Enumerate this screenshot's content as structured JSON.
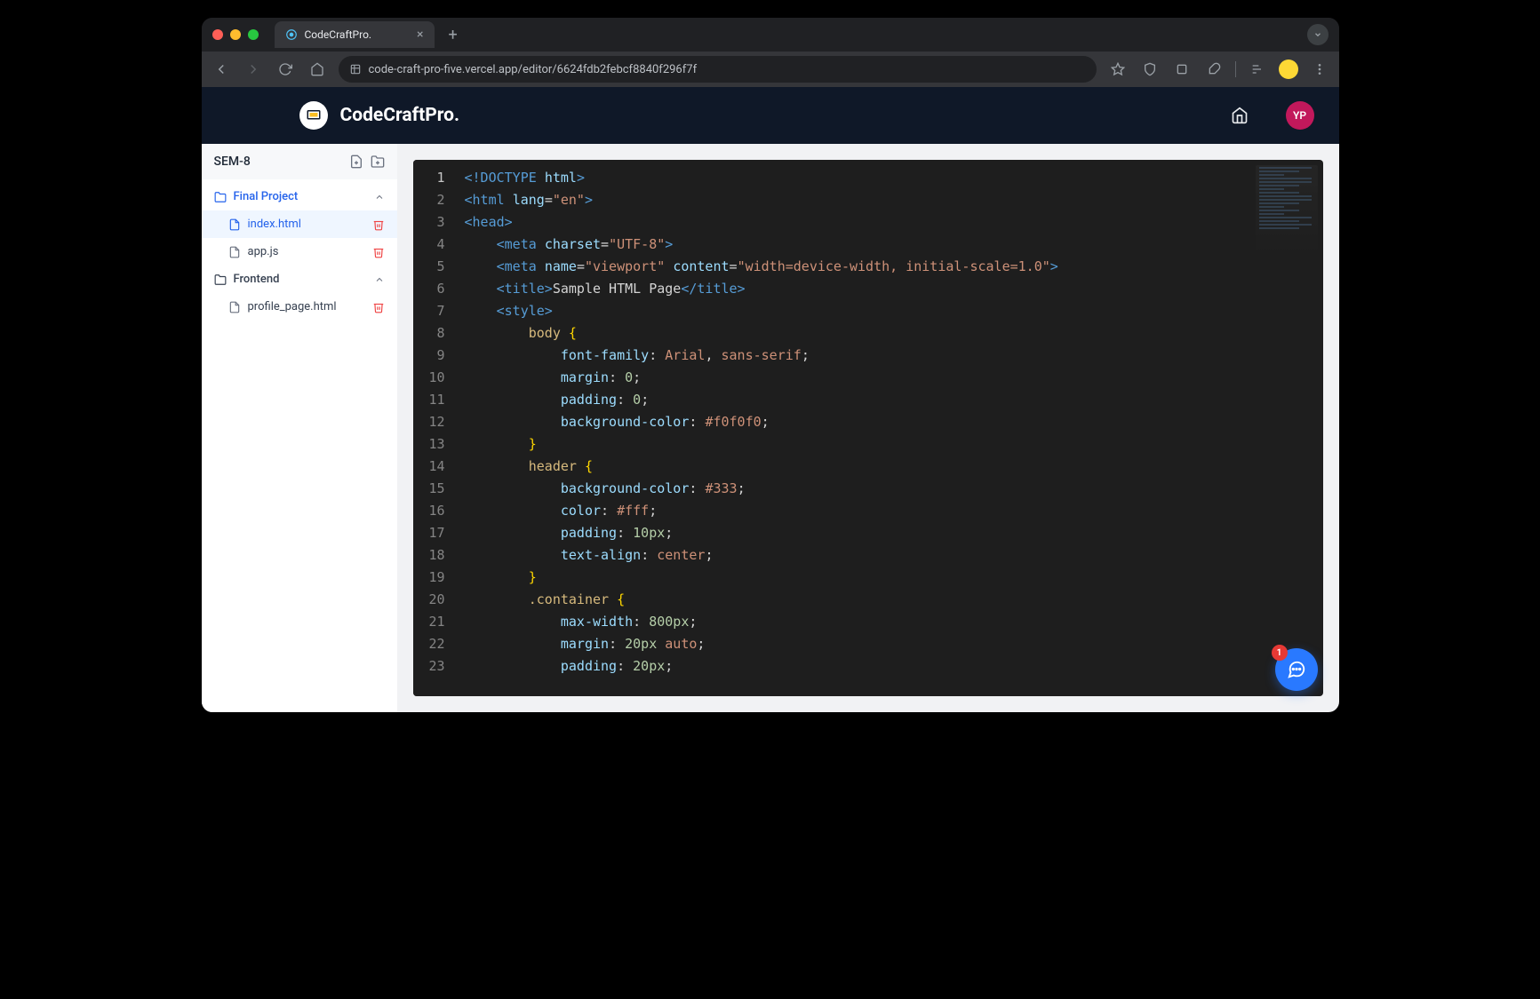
{
  "browser": {
    "tab_title": "CodeCraftPro.",
    "url": "code-craft-pro-five.vercel.app/editor/6624fdb2febcf8840f296f7f"
  },
  "header": {
    "brand": "CodeCraftPro.",
    "avatar_initials": "YP"
  },
  "sidebar": {
    "project_name": "SEM-8",
    "folders": [
      {
        "name": "Final Project",
        "expanded": true,
        "active": true,
        "files": [
          {
            "name": "index.html",
            "active": true
          },
          {
            "name": "app.js",
            "active": false
          }
        ]
      },
      {
        "name": "Frontend",
        "expanded": true,
        "active": false,
        "files": [
          {
            "name": "profile_page.html",
            "active": false
          }
        ]
      }
    ]
  },
  "editor": {
    "line_start": 1,
    "line_end": 23,
    "active_line": 1,
    "lines": [
      {
        "n": 1,
        "tokens": [
          [
            "tag",
            "<!DOCTYPE"
          ],
          [
            "text",
            " "
          ],
          [
            "attr",
            "html"
          ],
          [
            "tag",
            ">"
          ]
        ]
      },
      {
        "n": 2,
        "tokens": [
          [
            "tag",
            "<html"
          ],
          [
            "text",
            " "
          ],
          [
            "attr",
            "lang"
          ],
          [
            "punc",
            "="
          ],
          [
            "str",
            "\"en\""
          ],
          [
            "tag",
            ">"
          ]
        ]
      },
      {
        "n": 3,
        "tokens": [
          [
            "tag",
            "<head>"
          ]
        ]
      },
      {
        "n": 4,
        "indent": 1,
        "tokens": [
          [
            "tag",
            "<meta"
          ],
          [
            "text",
            " "
          ],
          [
            "attr",
            "charset"
          ],
          [
            "punc",
            "="
          ],
          [
            "str",
            "\"UTF-8\""
          ],
          [
            "tag",
            ">"
          ]
        ]
      },
      {
        "n": 5,
        "indent": 1,
        "tokens": [
          [
            "tag",
            "<meta"
          ],
          [
            "text",
            " "
          ],
          [
            "attr",
            "name"
          ],
          [
            "punc",
            "="
          ],
          [
            "str",
            "\"viewport\""
          ],
          [
            "text",
            " "
          ],
          [
            "attr",
            "content"
          ],
          [
            "punc",
            "="
          ],
          [
            "str",
            "\"width=device-width, initial-scale=1.0\""
          ],
          [
            "tag",
            ">"
          ]
        ]
      },
      {
        "n": 6,
        "indent": 1,
        "tokens": [
          [
            "tag",
            "<title>"
          ],
          [
            "text",
            "Sample HTML Page"
          ],
          [
            "tag",
            "</title>"
          ]
        ]
      },
      {
        "n": 7,
        "indent": 1,
        "tokens": [
          [
            "tag",
            "<style>"
          ]
        ]
      },
      {
        "n": 8,
        "indent": 2,
        "tokens": [
          [
            "sel",
            "body"
          ],
          [
            "text",
            " "
          ],
          [
            "brace",
            "{"
          ]
        ]
      },
      {
        "n": 9,
        "indent": 3,
        "tokens": [
          [
            "prop",
            "font-family"
          ],
          [
            "punc",
            ":"
          ],
          [
            "text",
            " "
          ],
          [
            "val",
            "Arial"
          ],
          [
            "punc",
            ","
          ],
          [
            "text",
            " "
          ],
          [
            "val",
            "sans-serif"
          ],
          [
            "punc",
            ";"
          ]
        ]
      },
      {
        "n": 10,
        "indent": 3,
        "tokens": [
          [
            "prop",
            "margin"
          ],
          [
            "punc",
            ":"
          ],
          [
            "text",
            " "
          ],
          [
            "num",
            "0"
          ],
          [
            "punc",
            ";"
          ]
        ]
      },
      {
        "n": 11,
        "indent": 3,
        "tokens": [
          [
            "prop",
            "padding"
          ],
          [
            "punc",
            ":"
          ],
          [
            "text",
            " "
          ],
          [
            "num",
            "0"
          ],
          [
            "punc",
            ";"
          ]
        ]
      },
      {
        "n": 12,
        "indent": 3,
        "tokens": [
          [
            "prop",
            "background-color"
          ],
          [
            "punc",
            ":"
          ],
          [
            "text",
            " "
          ],
          [
            "val",
            "#f0f0f0"
          ],
          [
            "punc",
            ";"
          ]
        ]
      },
      {
        "n": 13,
        "indent": 2,
        "tokens": [
          [
            "brace",
            "}"
          ]
        ]
      },
      {
        "n": 14,
        "indent": 2,
        "tokens": [
          [
            "sel",
            "header"
          ],
          [
            "text",
            " "
          ],
          [
            "brace",
            "{"
          ]
        ]
      },
      {
        "n": 15,
        "indent": 3,
        "tokens": [
          [
            "prop",
            "background-color"
          ],
          [
            "punc",
            ":"
          ],
          [
            "text",
            " "
          ],
          [
            "val",
            "#333"
          ],
          [
            "punc",
            ";"
          ]
        ]
      },
      {
        "n": 16,
        "indent": 3,
        "tokens": [
          [
            "prop",
            "color"
          ],
          [
            "punc",
            ":"
          ],
          [
            "text",
            " "
          ],
          [
            "val",
            "#fff"
          ],
          [
            "punc",
            ";"
          ]
        ]
      },
      {
        "n": 17,
        "indent": 3,
        "tokens": [
          [
            "prop",
            "padding"
          ],
          [
            "punc",
            ":"
          ],
          [
            "text",
            " "
          ],
          [
            "num",
            "10px"
          ],
          [
            "punc",
            ";"
          ]
        ]
      },
      {
        "n": 18,
        "indent": 3,
        "tokens": [
          [
            "prop",
            "text-align"
          ],
          [
            "punc",
            ":"
          ],
          [
            "text",
            " "
          ],
          [
            "val",
            "center"
          ],
          [
            "punc",
            ";"
          ]
        ]
      },
      {
        "n": 19,
        "indent": 2,
        "tokens": [
          [
            "brace",
            "}"
          ]
        ]
      },
      {
        "n": 20,
        "indent": 2,
        "tokens": [
          [
            "sel",
            ".container"
          ],
          [
            "text",
            " "
          ],
          [
            "brace",
            "{"
          ]
        ]
      },
      {
        "n": 21,
        "indent": 3,
        "tokens": [
          [
            "prop",
            "max-width"
          ],
          [
            "punc",
            ":"
          ],
          [
            "text",
            " "
          ],
          [
            "num",
            "800px"
          ],
          [
            "punc",
            ";"
          ]
        ]
      },
      {
        "n": 22,
        "indent": 3,
        "tokens": [
          [
            "prop",
            "margin"
          ],
          [
            "punc",
            ":"
          ],
          [
            "text",
            " "
          ],
          [
            "num",
            "20px"
          ],
          [
            "text",
            " "
          ],
          [
            "val",
            "auto"
          ],
          [
            "punc",
            ";"
          ]
        ]
      },
      {
        "n": 23,
        "indent": 3,
        "tokens": [
          [
            "prop",
            "padding"
          ],
          [
            "punc",
            ":"
          ],
          [
            "text",
            " "
          ],
          [
            "num",
            "20px"
          ],
          [
            "punc",
            ";"
          ]
        ]
      }
    ]
  },
  "chat": {
    "badge_count": "1"
  }
}
